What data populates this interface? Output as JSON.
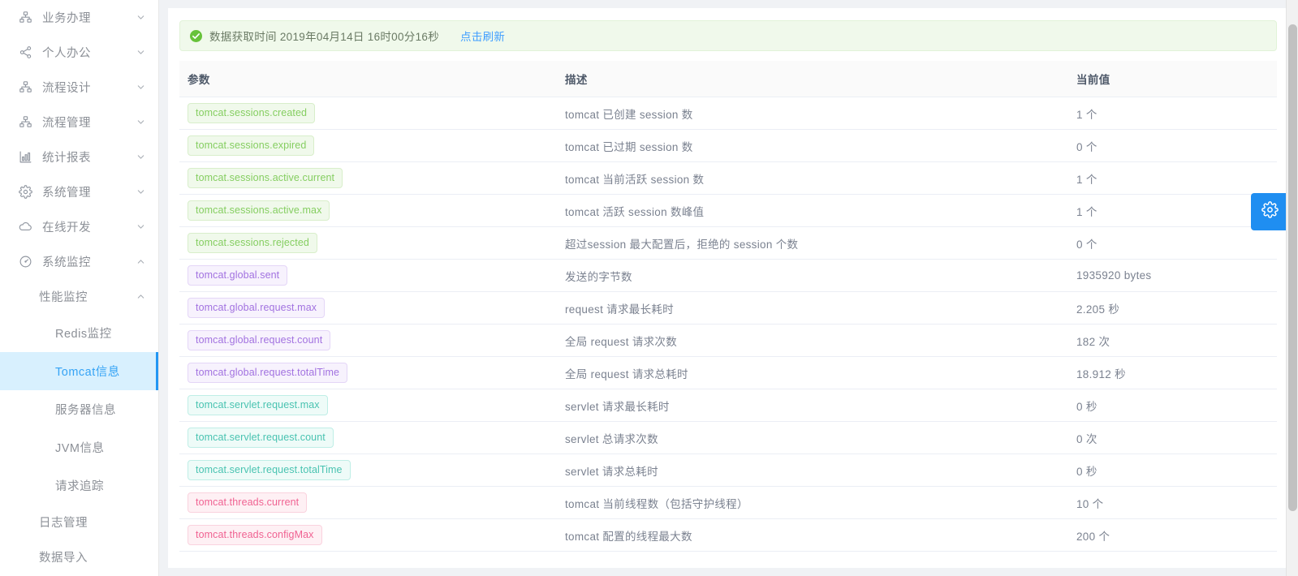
{
  "sidebar": {
    "level1": [
      {
        "label": "业务办理",
        "icon": "sitemap-icon",
        "arrow": "chevron-down-icon"
      },
      {
        "label": "个人办公",
        "icon": "share-icon",
        "arrow": "chevron-down-icon"
      },
      {
        "label": "流程设计",
        "icon": "sitemap-icon",
        "arrow": "chevron-down-icon"
      },
      {
        "label": "流程管理",
        "icon": "sitemap-icon",
        "arrow": "chevron-down-icon"
      },
      {
        "label": "统计报表",
        "icon": "bar-chart-icon",
        "arrow": "chevron-down-icon"
      },
      {
        "label": "系统管理",
        "icon": "gear-icon",
        "arrow": "chevron-down-icon"
      },
      {
        "label": "在线开发",
        "icon": "cloud-icon",
        "arrow": "chevron-down-icon"
      },
      {
        "label": "系统监控",
        "icon": "gauge-icon",
        "arrow": "chevron-up-icon"
      }
    ],
    "group_performance": {
      "label": "性能监控",
      "arrow": "chevron-up-icon"
    },
    "level3": [
      {
        "label": "Redis监控",
        "active": false
      },
      {
        "label": "Tomcat信息",
        "active": true
      },
      {
        "label": "服务器信息",
        "active": false
      },
      {
        "label": "JVM信息",
        "active": false
      },
      {
        "label": "请求追踪",
        "active": false
      }
    ],
    "tail": [
      {
        "label": "日志管理"
      },
      {
        "label": "数据导入"
      }
    ]
  },
  "alert": {
    "icon": "success-check-icon",
    "message": "数据获取时间 2019年04月14日 16时00分16秒",
    "refresh_label": "点击刷新",
    "bg_color": "#f0f9eb",
    "accent_color": "#67c23a",
    "link_color": "#409eff"
  },
  "table": {
    "columns": [
      "参数",
      "描述",
      "当前值"
    ],
    "rows": [
      {
        "param": "tomcat.sessions.created",
        "tone": "green",
        "desc": "tomcat 已创建 session 数",
        "value": "1 个"
      },
      {
        "param": "tomcat.sessions.expired",
        "tone": "green",
        "desc": "tomcat 已过期 session 数",
        "value": "0 个"
      },
      {
        "param": "tomcat.sessions.active.current",
        "tone": "green",
        "desc": "tomcat 当前活跃 session 数",
        "value": "1 个"
      },
      {
        "param": "tomcat.sessions.active.max",
        "tone": "green",
        "desc": "tomcat 活跃 session 数峰值",
        "value": "1 个"
      },
      {
        "param": "tomcat.sessions.rejected",
        "tone": "green",
        "desc": "超过session 最大配置后，拒绝的 session 个数",
        "value": "0 个"
      },
      {
        "param": "tomcat.global.sent",
        "tone": "purple",
        "desc": "发送的字节数",
        "value": "1935920 bytes"
      },
      {
        "param": "tomcat.global.request.max",
        "tone": "purple",
        "desc": "request 请求最长耗时",
        "value": "2.205 秒"
      },
      {
        "param": "tomcat.global.request.count",
        "tone": "purple",
        "desc": "全局 request 请求次数",
        "value": "182 次"
      },
      {
        "param": "tomcat.global.request.totalTime",
        "tone": "purple",
        "desc": "全局 request 请求总耗时",
        "value": "18.912 秒"
      },
      {
        "param": "tomcat.servlet.request.max",
        "tone": "cyan",
        "desc": "servlet 请求最长耗时",
        "value": "0 秒"
      },
      {
        "param": "tomcat.servlet.request.count",
        "tone": "cyan",
        "desc": "servlet 总请求次数",
        "value": "0 次"
      },
      {
        "param": "tomcat.servlet.request.totalTime",
        "tone": "cyan",
        "desc": "servlet 请求总耗时",
        "value": "0 秒"
      },
      {
        "param": "tomcat.threads.current",
        "tone": "pink",
        "desc": "tomcat 当前线程数（包括守护线程）",
        "value": "10 个"
      },
      {
        "param": "tomcat.threads.configMax",
        "tone": "pink",
        "desc": "tomcat 配置的线程最大数",
        "value": "200 个"
      }
    ]
  },
  "fab": {
    "icon": "gear-icon",
    "color": "#1f8ef1"
  }
}
